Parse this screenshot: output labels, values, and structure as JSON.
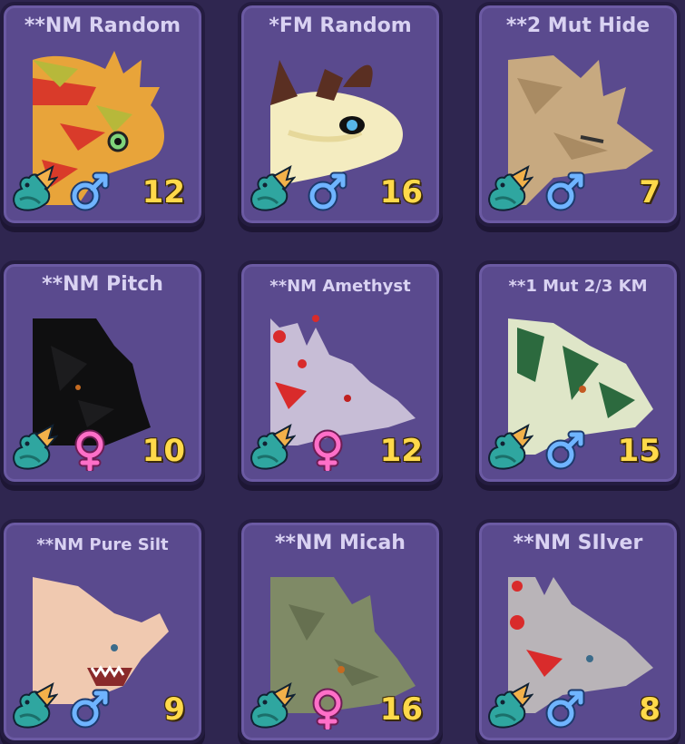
{
  "colors": {
    "background": "#2f2650",
    "card": "#5a4a8e",
    "age_text": "#ffd94a",
    "male": "#6fb4ff",
    "female": "#ff6fc8"
  },
  "cards": [
    {
      "name": "**NM Random",
      "gender": "male",
      "age": "12",
      "species_icon": "wyvern-species-icon"
    },
    {
      "name": "*FM Random",
      "gender": "male",
      "age": "16",
      "species_icon": "wyvern-species-icon"
    },
    {
      "name": "**2 Mut Hide",
      "gender": "male",
      "age": "7",
      "species_icon": "wyvern-species-icon"
    },
    {
      "name": "**NM Pitch",
      "gender": "female",
      "age": "10",
      "species_icon": "wyvern-species-icon"
    },
    {
      "name": "**NM Amethyst",
      "gender": "female",
      "age": "12",
      "species_icon": "wyvern-species-icon"
    },
    {
      "name": "**1 Mut 2/3 KM",
      "gender": "male",
      "age": "15",
      "species_icon": "wyvern-species-icon"
    },
    {
      "name": "**NM Pure Silt",
      "gender": "male",
      "age": "9",
      "species_icon": "wyvern-species-icon"
    },
    {
      "name": "**NM Micah",
      "gender": "female",
      "age": "16",
      "species_icon": "wyvern-species-icon"
    },
    {
      "name": "**NM SIlver",
      "gender": "male",
      "age": "8",
      "species_icon": "wyvern-species-icon"
    }
  ]
}
